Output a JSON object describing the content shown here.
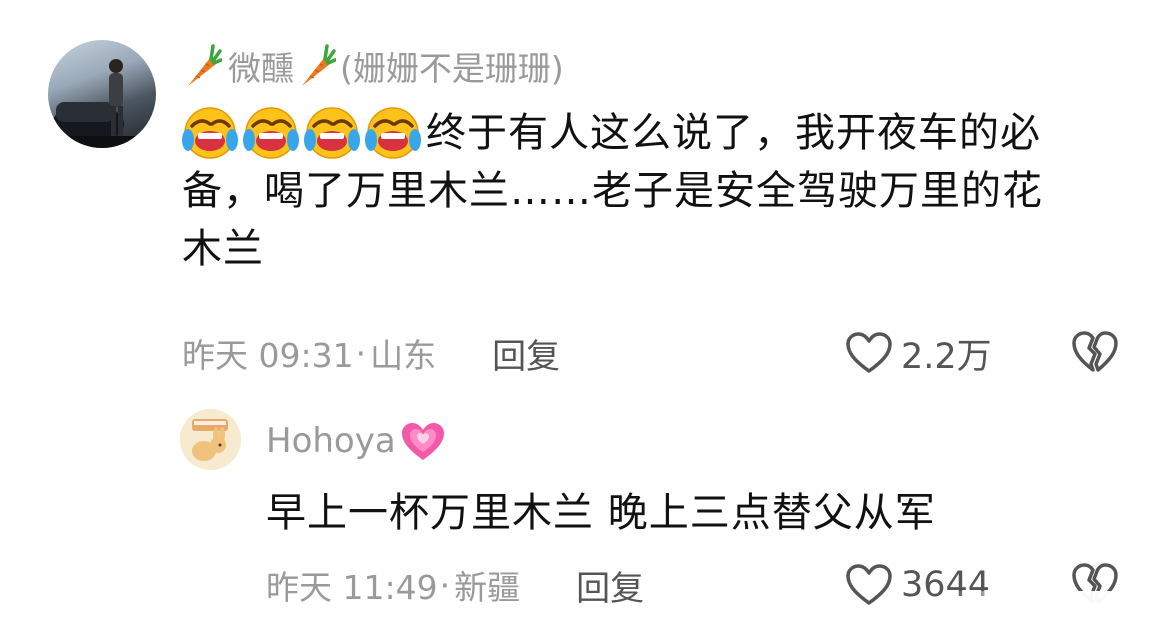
{
  "comment": {
    "username": "微醺",
    "username_note": "(姗姗不是珊珊)",
    "emoji_names": [
      "rolling-laughing-icon",
      "rolling-laughing-icon",
      "rolling-laughing-icon",
      "rolling-laughing-icon"
    ],
    "text_line1": "终于有人这么说了，我开夜车的必",
    "text_line2": "备，喝了万里木兰……老子是安全驾驶万里的花",
    "text_line3": "木兰",
    "time": "昨天 09:31",
    "separator": "·",
    "location": "山东",
    "reply_label": "回复",
    "likes": "2.2万"
  },
  "reply": {
    "username": "Hohoya",
    "text": "早上一杯万里木兰 晚上三点替父从军",
    "time": "昨天 11:49",
    "separator": "·",
    "location": "新疆",
    "reply_label": "回复",
    "likes": "3644"
  },
  "colors": {
    "meta_gray": "#9a9a9a",
    "text_dark": "#111111",
    "heart_pink": "#f25aa9",
    "carrot_orange": "#ef7a1e"
  }
}
